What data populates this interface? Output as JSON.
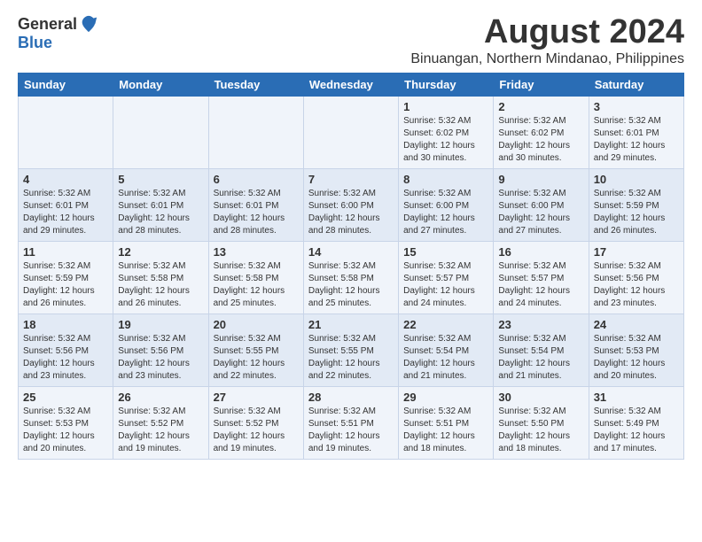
{
  "header": {
    "logo_general": "General",
    "logo_blue": "Blue",
    "month_title": "August 2024",
    "location": "Binuangan, Northern Mindanao, Philippines"
  },
  "days_of_week": [
    "Sunday",
    "Monday",
    "Tuesday",
    "Wednesday",
    "Thursday",
    "Friday",
    "Saturday"
  ],
  "weeks": [
    [
      {
        "day": "",
        "sunrise": "",
        "sunset": "",
        "daylight": ""
      },
      {
        "day": "",
        "sunrise": "",
        "sunset": "",
        "daylight": ""
      },
      {
        "day": "",
        "sunrise": "",
        "sunset": "",
        "daylight": ""
      },
      {
        "day": "",
        "sunrise": "",
        "sunset": "",
        "daylight": ""
      },
      {
        "day": "1",
        "sunrise": "Sunrise: 5:32 AM",
        "sunset": "Sunset: 6:02 PM",
        "daylight": "Daylight: 12 hours and 30 minutes."
      },
      {
        "day": "2",
        "sunrise": "Sunrise: 5:32 AM",
        "sunset": "Sunset: 6:02 PM",
        "daylight": "Daylight: 12 hours and 30 minutes."
      },
      {
        "day": "3",
        "sunrise": "Sunrise: 5:32 AM",
        "sunset": "Sunset: 6:01 PM",
        "daylight": "Daylight: 12 hours and 29 minutes."
      }
    ],
    [
      {
        "day": "4",
        "sunrise": "Sunrise: 5:32 AM",
        "sunset": "Sunset: 6:01 PM",
        "daylight": "Daylight: 12 hours and 29 minutes."
      },
      {
        "day": "5",
        "sunrise": "Sunrise: 5:32 AM",
        "sunset": "Sunset: 6:01 PM",
        "daylight": "Daylight: 12 hours and 28 minutes."
      },
      {
        "day": "6",
        "sunrise": "Sunrise: 5:32 AM",
        "sunset": "Sunset: 6:01 PM",
        "daylight": "Daylight: 12 hours and 28 minutes."
      },
      {
        "day": "7",
        "sunrise": "Sunrise: 5:32 AM",
        "sunset": "Sunset: 6:00 PM",
        "daylight": "Daylight: 12 hours and 28 minutes."
      },
      {
        "day": "8",
        "sunrise": "Sunrise: 5:32 AM",
        "sunset": "Sunset: 6:00 PM",
        "daylight": "Daylight: 12 hours and 27 minutes."
      },
      {
        "day": "9",
        "sunrise": "Sunrise: 5:32 AM",
        "sunset": "Sunset: 6:00 PM",
        "daylight": "Daylight: 12 hours and 27 minutes."
      },
      {
        "day": "10",
        "sunrise": "Sunrise: 5:32 AM",
        "sunset": "Sunset: 5:59 PM",
        "daylight": "Daylight: 12 hours and 26 minutes."
      }
    ],
    [
      {
        "day": "11",
        "sunrise": "Sunrise: 5:32 AM",
        "sunset": "Sunset: 5:59 PM",
        "daylight": "Daylight: 12 hours and 26 minutes."
      },
      {
        "day": "12",
        "sunrise": "Sunrise: 5:32 AM",
        "sunset": "Sunset: 5:58 PM",
        "daylight": "Daylight: 12 hours and 26 minutes."
      },
      {
        "day": "13",
        "sunrise": "Sunrise: 5:32 AM",
        "sunset": "Sunset: 5:58 PM",
        "daylight": "Daylight: 12 hours and 25 minutes."
      },
      {
        "day": "14",
        "sunrise": "Sunrise: 5:32 AM",
        "sunset": "Sunset: 5:58 PM",
        "daylight": "Daylight: 12 hours and 25 minutes."
      },
      {
        "day": "15",
        "sunrise": "Sunrise: 5:32 AM",
        "sunset": "Sunset: 5:57 PM",
        "daylight": "Daylight: 12 hours and 24 minutes."
      },
      {
        "day": "16",
        "sunrise": "Sunrise: 5:32 AM",
        "sunset": "Sunset: 5:57 PM",
        "daylight": "Daylight: 12 hours and 24 minutes."
      },
      {
        "day": "17",
        "sunrise": "Sunrise: 5:32 AM",
        "sunset": "Sunset: 5:56 PM",
        "daylight": "Daylight: 12 hours and 23 minutes."
      }
    ],
    [
      {
        "day": "18",
        "sunrise": "Sunrise: 5:32 AM",
        "sunset": "Sunset: 5:56 PM",
        "daylight": "Daylight: 12 hours and 23 minutes."
      },
      {
        "day": "19",
        "sunrise": "Sunrise: 5:32 AM",
        "sunset": "Sunset: 5:56 PM",
        "daylight": "Daylight: 12 hours and 23 minutes."
      },
      {
        "day": "20",
        "sunrise": "Sunrise: 5:32 AM",
        "sunset": "Sunset: 5:55 PM",
        "daylight": "Daylight: 12 hours and 22 minutes."
      },
      {
        "day": "21",
        "sunrise": "Sunrise: 5:32 AM",
        "sunset": "Sunset: 5:55 PM",
        "daylight": "Daylight: 12 hours and 22 minutes."
      },
      {
        "day": "22",
        "sunrise": "Sunrise: 5:32 AM",
        "sunset": "Sunset: 5:54 PM",
        "daylight": "Daylight: 12 hours and 21 minutes."
      },
      {
        "day": "23",
        "sunrise": "Sunrise: 5:32 AM",
        "sunset": "Sunset: 5:54 PM",
        "daylight": "Daylight: 12 hours and 21 minutes."
      },
      {
        "day": "24",
        "sunrise": "Sunrise: 5:32 AM",
        "sunset": "Sunset: 5:53 PM",
        "daylight": "Daylight: 12 hours and 20 minutes."
      }
    ],
    [
      {
        "day": "25",
        "sunrise": "Sunrise: 5:32 AM",
        "sunset": "Sunset: 5:53 PM",
        "daylight": "Daylight: 12 hours and 20 minutes."
      },
      {
        "day": "26",
        "sunrise": "Sunrise: 5:32 AM",
        "sunset": "Sunset: 5:52 PM",
        "daylight": "Daylight: 12 hours and 19 minutes."
      },
      {
        "day": "27",
        "sunrise": "Sunrise: 5:32 AM",
        "sunset": "Sunset: 5:52 PM",
        "daylight": "Daylight: 12 hours and 19 minutes."
      },
      {
        "day": "28",
        "sunrise": "Sunrise: 5:32 AM",
        "sunset": "Sunset: 5:51 PM",
        "daylight": "Daylight: 12 hours and 19 minutes."
      },
      {
        "day": "29",
        "sunrise": "Sunrise: 5:32 AM",
        "sunset": "Sunset: 5:51 PM",
        "daylight": "Daylight: 12 hours and 18 minutes."
      },
      {
        "day": "30",
        "sunrise": "Sunrise: 5:32 AM",
        "sunset": "Sunset: 5:50 PM",
        "daylight": "Daylight: 12 hours and 18 minutes."
      },
      {
        "day": "31",
        "sunrise": "Sunrise: 5:32 AM",
        "sunset": "Sunset: 5:49 PM",
        "daylight": "Daylight: 12 hours and 17 minutes."
      }
    ]
  ]
}
